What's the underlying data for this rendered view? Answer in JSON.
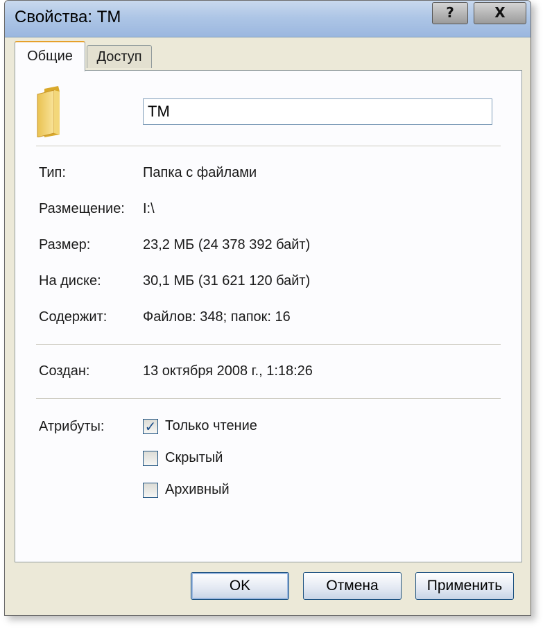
{
  "window": {
    "title": "Свойства: TM"
  },
  "titlebar": {
    "help_label": "?",
    "close_label": "X"
  },
  "tabs": [
    {
      "label": "Общие"
    },
    {
      "label": "Доступ"
    }
  ],
  "general": {
    "folder_icon": "folder-icon",
    "name_value": "TM",
    "rows": {
      "type": {
        "label": "Тип:",
        "value": "Папка с файлами"
      },
      "location": {
        "label": "Размещение:",
        "value": "I:\\"
      },
      "size": {
        "label": "Размер:",
        "value": "23,2 МБ (24 378 392 байт)"
      },
      "on_disk": {
        "label": "На диске:",
        "value": "30,1 МБ (31 621 120 байт)"
      },
      "contains": {
        "label": "Содержит:",
        "value": "Файлов: 348; папок: 16"
      },
      "created": {
        "label": "Создан:",
        "value": "13 октября 2008 г., 1:18:26"
      }
    },
    "attributes": {
      "label": "Атрибуты:",
      "items": [
        {
          "label": "Только чтение",
          "checked": true,
          "mark": "✓"
        },
        {
          "label": "Скрытый",
          "checked": false
        },
        {
          "label": "Архивный",
          "checked": false
        }
      ]
    }
  },
  "buttons": {
    "ok": "OK",
    "cancel": "Отмена",
    "apply": "Применить"
  }
}
